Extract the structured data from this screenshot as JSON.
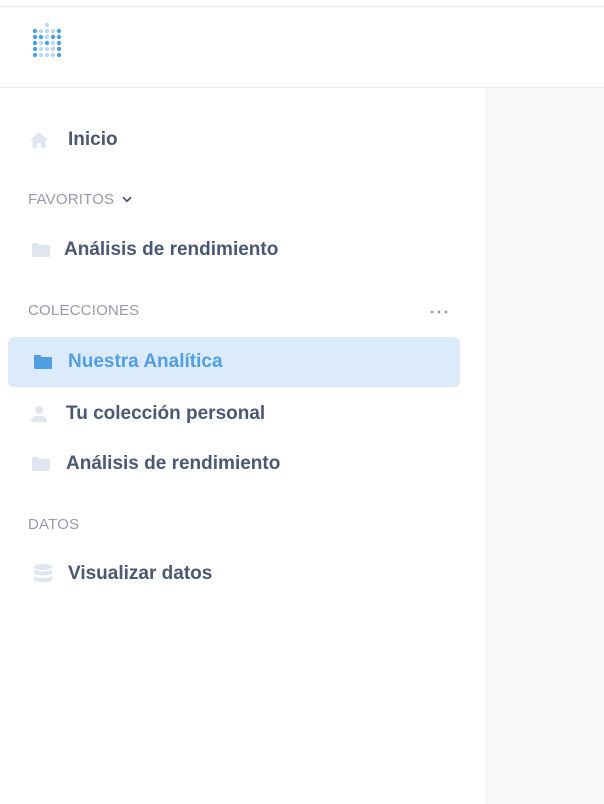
{
  "app": {
    "logo_name": "metabase-logo"
  },
  "sidebar": {
    "home": {
      "label": "Inicio",
      "icon": "home-icon"
    },
    "favorites": {
      "title": "FAVORITOS",
      "items": [
        {
          "label": "Análisis de rendimiento",
          "icon": "folder-icon"
        }
      ]
    },
    "collections": {
      "title": "COLECCIONES",
      "more_icon": "ellipsis-icon",
      "items": [
        {
          "label": "Nuestra Analítica",
          "icon": "folder-icon",
          "active": true
        },
        {
          "label": "Tu colección personal",
          "icon": "person-icon"
        },
        {
          "label": "Análisis de rendimiento",
          "icon": "folder-icon"
        }
      ]
    },
    "data": {
      "title": "DATOS",
      "items": [
        {
          "label": "Visualizar datos",
          "icon": "database-icon"
        }
      ]
    }
  },
  "colors": {
    "accent": "#509ee3",
    "active_bg": "#dcebf9",
    "text": "#4c5773",
    "muted": "#949aab",
    "icon_muted": "#dfe6ef"
  }
}
